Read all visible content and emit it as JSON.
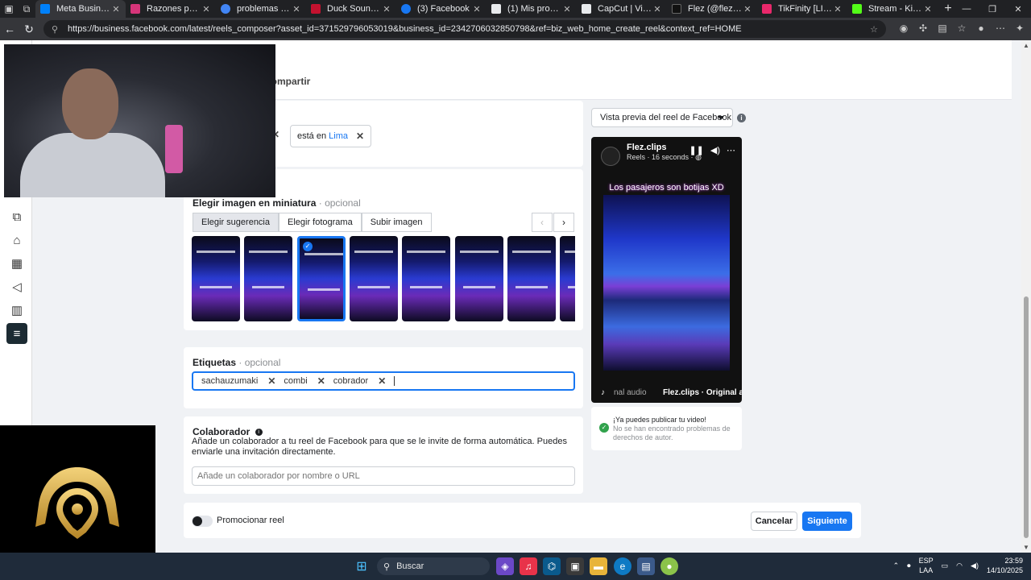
{
  "browser": {
    "tabs": [
      {
        "label": "Meta Business",
        "color": "#0081fb"
      },
      {
        "label": "Razones por las que",
        "color": "#d6357a"
      },
      {
        "label": "problemas con poli",
        "color": "#4285f4"
      },
      {
        "label": "Duck Soundboard",
        "color": "#c4122f"
      },
      {
        "label": "(3) Facebook",
        "color": "#1877f2"
      },
      {
        "label": "(1) Mis proyectos",
        "color": "#e8eaed"
      },
      {
        "label": "CapCut | Video Edit",
        "color": "#e8eaed"
      },
      {
        "label": "Flez (@flezdx) está",
        "color": "#111111"
      },
      {
        "label": "TikFinity [LIVE] [1 V",
        "color": "#e9286b"
      },
      {
        "label": "Stream - Kick Dash",
        "color": "#53fc18"
      }
    ],
    "url": "https://business.facebook.com/latest/reels_composer?asset_id=371529796053019&business_id=2342706032850798&ref=biz_web_home_create_reel&context_ref=HOME"
  },
  "composer": {
    "share_option": "Compartir",
    "location": {
      "prefix": "está en",
      "city": "Lima"
    },
    "thumbnail": {
      "title": "Elegir imagen en miniatura",
      "optional": "opcional",
      "tabs": [
        "Elegir sugerencia",
        "Elegir fotograma",
        "Subir imagen"
      ],
      "selected_tab": "Elegir sugerencia",
      "selected_index": 2
    },
    "tags": {
      "title": "Etiquetas",
      "optional": "opcional",
      "items": [
        "sachauzumaki",
        "combi",
        "cobrador"
      ]
    },
    "collaborator": {
      "title": "Colaborador",
      "description": "Añade un colaborador a tu reel de Facebook para que se le invite de forma automática. Puedes enviarle una invitación directamente.",
      "placeholder": "Añade un colaborador por nombre o URL"
    },
    "promote_label": "Promocionar reel",
    "cancel_label": "Cancelar",
    "next_label": "Siguiente"
  },
  "preview": {
    "dropdown_label": "Vista previa del reel de Facebook",
    "account": "Flez.clips",
    "meta": "Reels · 16 seconds ·",
    "video_title": "Los pasajeros son botijas XD",
    "audio": "nal audio",
    "audio_origin": "Flez.clips · Original au",
    "publish_title": "¡Ya puedes publicar tu video!",
    "publish_note": "No se han encontrado problemas de derechos de autor."
  },
  "taskbar": {
    "search_label": "Buscar",
    "lang_top": "ESP",
    "lang_bottom": "LAA",
    "time": "23:59",
    "date": "14/10/2025"
  }
}
